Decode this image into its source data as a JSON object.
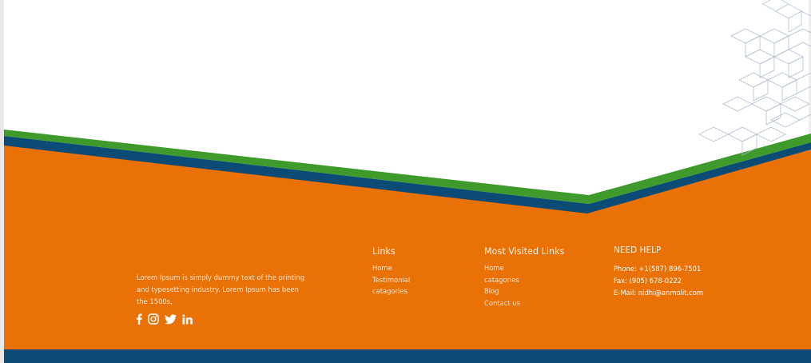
{
  "colors": {
    "orange": "#ea7106",
    "green": "#3e9b2b",
    "navy": "#0b4b75"
  },
  "footer": {
    "about_text": "Lorem Ipsum is simply dummy text of the printing and typesetting industry. Lorem Ipsum has been the 1500s,",
    "social": [
      "facebook-icon",
      "instagram-icon",
      "twitter-icon",
      "linkedin-icon"
    ],
    "links": {
      "title": "Links",
      "items": [
        "Home",
        "Testimonial",
        "catagories"
      ]
    },
    "most_visited": {
      "title": "Most Visited Links",
      "items": [
        "Home",
        "catagories",
        "Blog",
        "Contact us"
      ]
    },
    "help": {
      "title": "NEED HELP",
      "phone": "Phone: +1(587) 896-7501",
      "fax": "Fax: (905) 678-0222",
      "email": "E-Mail: nidhi@anmolit.com"
    }
  }
}
